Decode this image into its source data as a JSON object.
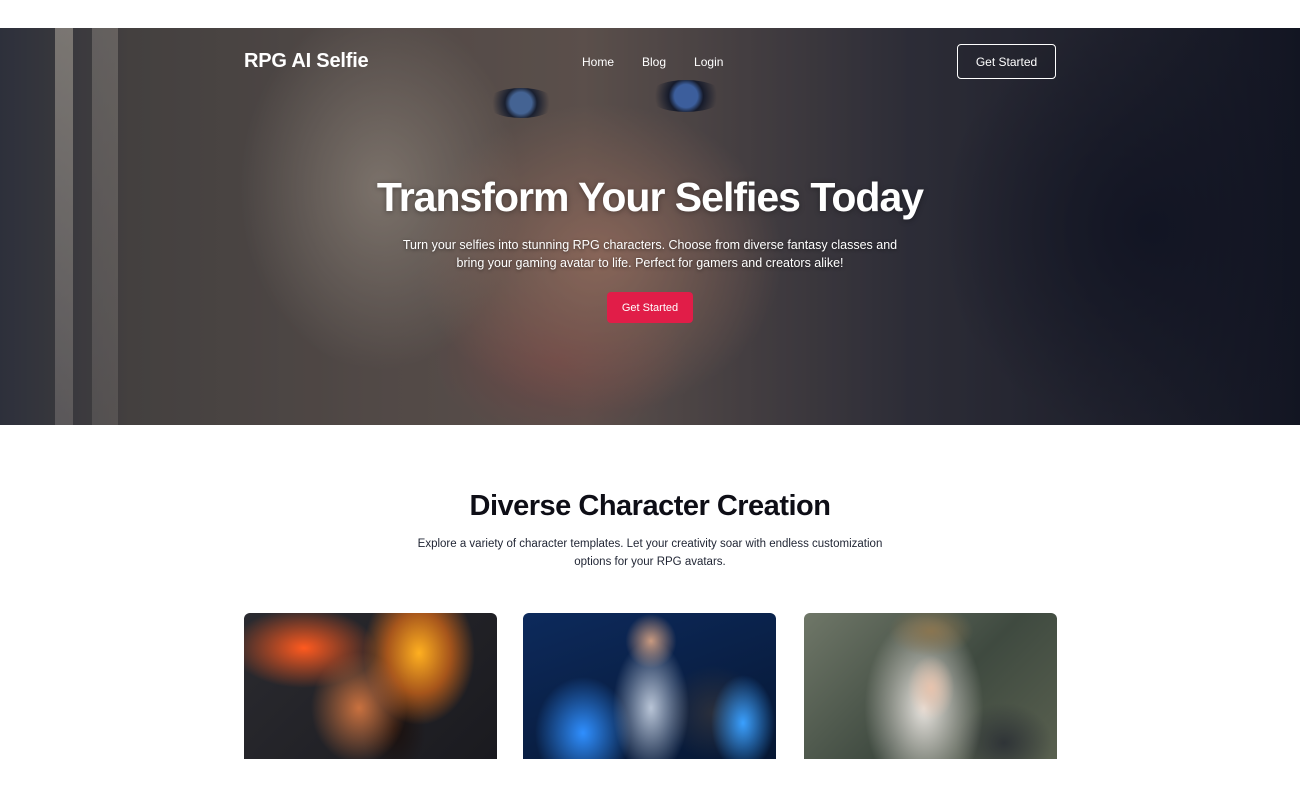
{
  "nav": {
    "brand": "RPG AI Selfie",
    "links": [
      "Home",
      "Blog",
      "Login"
    ],
    "cta_label": "Get Started"
  },
  "hero": {
    "title": "Transform Your Selfies Today",
    "subtitle": "Turn your selfies into stunning RPG characters. Choose from diverse fantasy classes and bring your gaming avatar to life. Perfect for gamers and creators alike!",
    "cta_label": "Get Started",
    "background_image": "fantasy-elf-portrait"
  },
  "characters": {
    "title": "Diverse Character Creation",
    "subtitle": "Explore a variety of character templates. Let your creativity soar with endless customization options for your RPG avatars.",
    "cards": [
      {
        "image": "fire-warrior-portrait"
      },
      {
        "image": "ice-wizard-portrait"
      },
      {
        "image": "elf-queen-portrait"
      }
    ]
  },
  "colors": {
    "accent": "#e11d48",
    "heading": "#0e0e16",
    "hero_text": "#ffffff"
  }
}
